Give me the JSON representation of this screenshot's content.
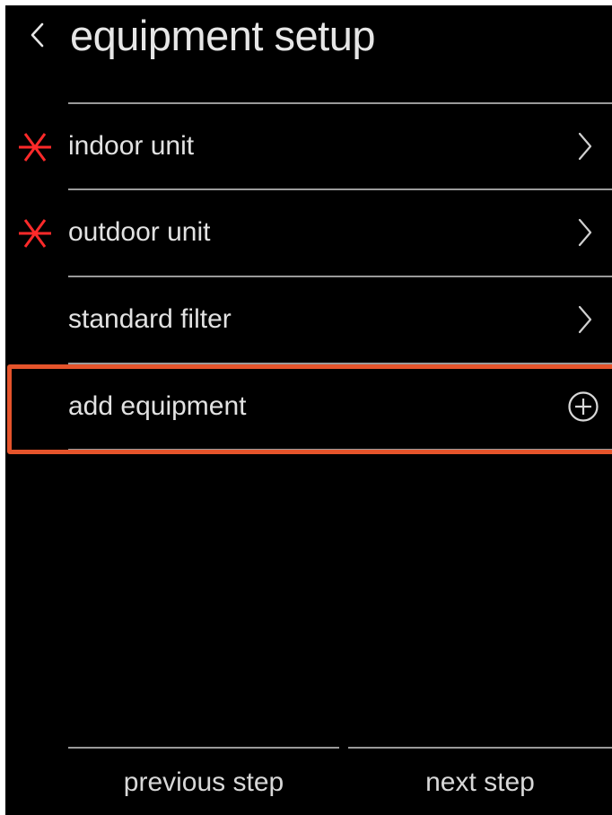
{
  "header": {
    "title": "equipment setup",
    "back_icon": "chevron-left-icon"
  },
  "items": [
    {
      "label": "indoor unit",
      "required": true,
      "action_icon": "chevron-right-icon"
    },
    {
      "label": "outdoor unit",
      "required": true,
      "action_icon": "chevron-right-icon"
    },
    {
      "label": "standard filter",
      "required": false,
      "action_icon": "chevron-right-icon"
    },
    {
      "label": "add equipment",
      "required": false,
      "action_icon": "plus-circle-icon",
      "highlighted": true
    }
  ],
  "footer": {
    "previous_label": "previous step",
    "next_label": "next step"
  },
  "colors": {
    "background": "#000000",
    "text": "#e2e2e2",
    "divider": "#9a9a9a",
    "required": "#ff2a2a",
    "highlight": "#e5542b"
  }
}
